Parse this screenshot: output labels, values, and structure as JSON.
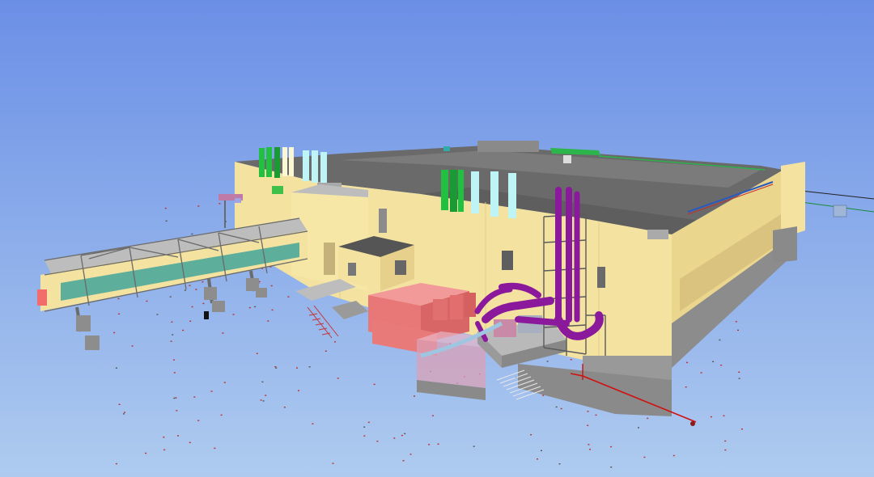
{
  "viewer": {
    "sky_color_top": "#6b8fe6",
    "sky_color_bottom": "#a8c8f0",
    "building_wall_color": "#f4e3a0",
    "roof_color": "#6b6b6b",
    "steel_color": "#7c7c7c",
    "pipe_purple_color": "#8a1a9b",
    "pipe_red_color": "#d01010",
    "equipment_pink_color": "#e87878",
    "stack_green_color": "#22c040",
    "stack_cyan_color": "#bff4f6",
    "stack_cream_color": "#fbf7d2",
    "window_blue_color": "#43a59b"
  }
}
